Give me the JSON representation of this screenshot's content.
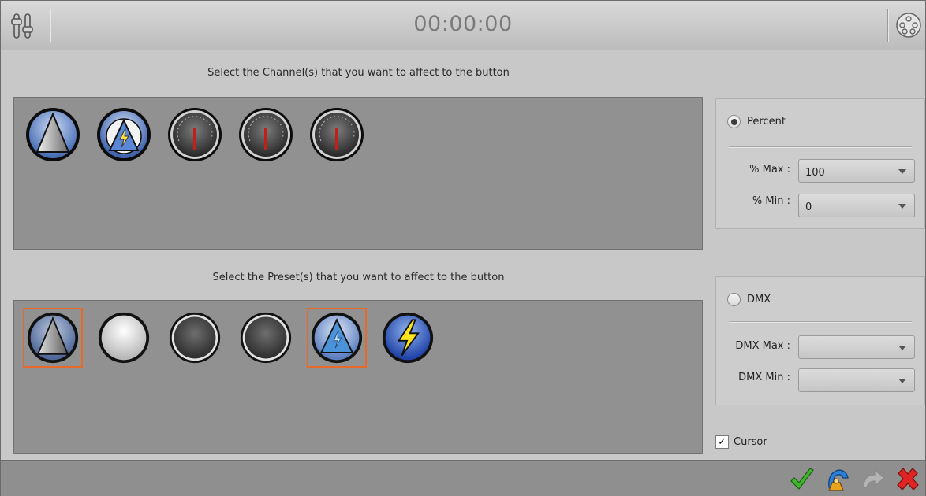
{
  "titlebar": {
    "timer": "00:00:00",
    "left_icon": "sliders-icon",
    "right_icon": "dmx-connector-icon"
  },
  "channels": {
    "label": "Select the Channel(s) that you want to affect to the button",
    "items": [
      {
        "name": "dimmer-triangle-icon"
      },
      {
        "name": "strobe-lightning-icon"
      },
      {
        "name": "gauge-icon"
      },
      {
        "name": "gauge-icon"
      },
      {
        "name": "gauge-icon"
      }
    ]
  },
  "presets": {
    "label": "Select the Preset(s) that you want to affect to the button",
    "items": [
      {
        "name": "dimmer-triangle-icon",
        "selected": true
      },
      {
        "name": "white-circle-icon",
        "selected": false
      },
      {
        "name": "dark-circle-icon",
        "selected": false
      },
      {
        "name": "dark-circle-icon",
        "selected": false
      },
      {
        "name": "blue-triangle-strobe-icon",
        "selected": true
      },
      {
        "name": "lightning-icon",
        "selected": false
      }
    ]
  },
  "percent_group": {
    "radio_label": "Percent",
    "selected": true,
    "max_label": "% Max :",
    "max_value": "100",
    "min_label": "% Min :",
    "min_value": "0"
  },
  "dmx_group": {
    "radio_label": "DMX",
    "selected": false,
    "max_label": "DMX Max :",
    "max_value": "",
    "min_label": "DMX Min :",
    "min_value": ""
  },
  "cursor": {
    "label": "Cursor",
    "checked": true,
    "mark": "✓"
  },
  "bottombar": {
    "buttons": [
      "ok-check-icon",
      "wizard-icon",
      "redo-arrow-icon",
      "cancel-x-icon"
    ]
  },
  "colors": {
    "selection_outline": "#e86a2a",
    "panel_bg": "#919191",
    "window_bg": "#c8c8c8"
  }
}
